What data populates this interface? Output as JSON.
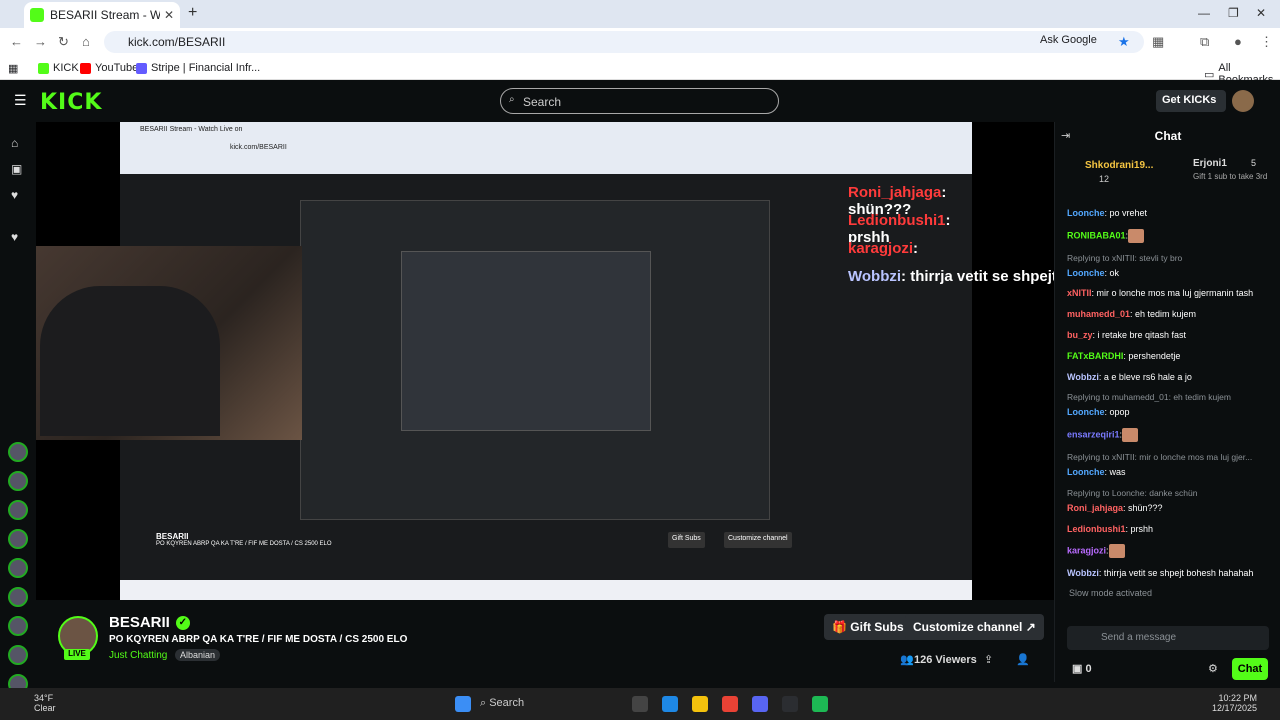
{
  "browser": {
    "tab_title": "BESARII Stream - Watch Live on",
    "url": "kick.com/BESARII",
    "ask_google": "Ask Google",
    "bookmarks": [
      "KICK",
      "YouTube",
      "Stripe | Financial Infr..."
    ],
    "all_bookmarks": "All Bookmarks"
  },
  "kick": {
    "logo": "KICK",
    "search_placeholder": "Search",
    "get_kicks": "Get KICKs"
  },
  "overlay_chat": [
    {
      "user": "Roni_jahjaga",
      "text": ": shün???"
    },
    {
      "user": "Ledionbushi1",
      "text": ": prshh"
    },
    {
      "user": "karagjozi",
      "text": ":"
    },
    {
      "user": "Wobbzi",
      "text": ": thirrja vetit se shpejt bohesh hahahah"
    }
  ],
  "streamer": {
    "name": "BESARII",
    "title": "PO KQYREN ABRP QA KA T'RE / FIF ME DOSTA / CS 2500 ELO",
    "category": "Just Chatting",
    "tag": "Albanian",
    "live": "LIVE",
    "gift_subs": "Gift Subs",
    "customize": "Customize channel",
    "viewers": "126 Viewers"
  },
  "chat": {
    "header": "Chat",
    "pinned": {
      "user": "Shkodrani19...",
      "count": "12",
      "other": "Erjoni1",
      "other_count": "5",
      "note": "Gift 1 sub to take 3rd"
    },
    "messages": [
      {
        "reply": "",
        "user": "Loonche",
        "color": "#53a8ff",
        "text": ": po vrehet"
      },
      {
        "reply": "",
        "user": "RONIBABA01",
        "color": "#53fc18",
        "text": ":"
      },
      {
        "reply": "Replying to xNITII: stevli ty bro",
        "user": "Loonche",
        "color": "#53a8ff",
        "text": ": ok"
      },
      {
        "reply": "",
        "user": "xNITII",
        "color": "#ff6262",
        "text": ": mir o lonche mos ma luj gjermanin tash"
      },
      {
        "reply": "",
        "user": "muhamedd_01",
        "color": "#ff6262",
        "text": ": eh tedim kujem"
      },
      {
        "reply": "",
        "user": "bu_zy",
        "color": "#ff6262",
        "text": ": i retake bre qitash fast"
      },
      {
        "reply": "",
        "user": "FATxBARDHI",
        "color": "#53fc18",
        "text": ": pershendetje"
      },
      {
        "reply": "",
        "user": "Wobbzi",
        "color": "#b9c4ff",
        "text": ": a e bleve rs6 hale a jo"
      },
      {
        "reply": "Replying to muhamedd_01: eh tedim kujem",
        "user": "Loonche",
        "color": "#53a8ff",
        "text": ": opop"
      },
      {
        "reply": "",
        "user": "ensarzeqiri1",
        "color": "#7a7aff",
        "text": ":"
      },
      {
        "reply": "Replying to xNITII: mir o lonche mos ma luj gjer...",
        "user": "Loonche",
        "color": "#53a8ff",
        "text": ": was"
      },
      {
        "reply": "Replying to Loonche: danke schün",
        "user": "Roni_jahjaga",
        "color": "#ff6262",
        "text": ": shün???"
      },
      {
        "reply": "",
        "user": "Ledionbushi1",
        "color": "#ff6262",
        "text": ": prshh"
      },
      {
        "reply": "",
        "user": "karagjozi",
        "color": "#b96bff",
        "text": ":"
      },
      {
        "reply": "",
        "user": "Wobbzi",
        "color": "#b9c4ff",
        "text": ": thirrja vetit se shpejt bohesh hahahah"
      }
    ],
    "slow_mode": "Slow mode activated",
    "placeholder": "Send a message",
    "points": "0",
    "send": "Chat"
  },
  "taskbar": {
    "temp": "34°F",
    "condition": "Clear",
    "search": "Search",
    "time": "10:22 PM",
    "date": "12/17/2025"
  }
}
